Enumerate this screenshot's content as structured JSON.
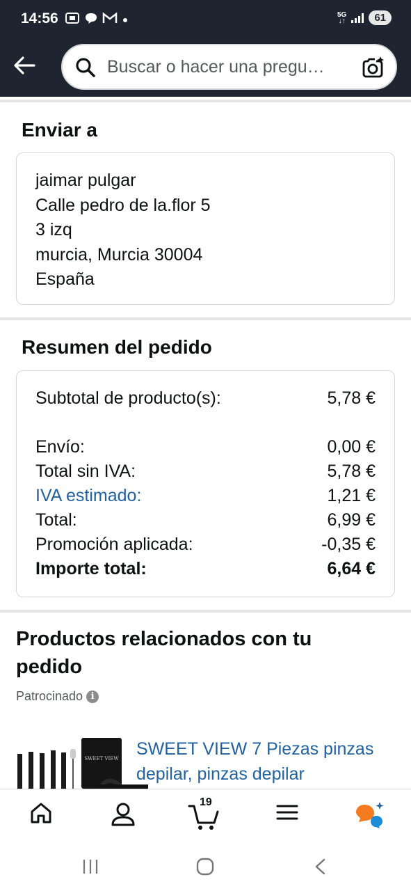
{
  "status_bar": {
    "time": "14:56",
    "network": "5G",
    "battery": "61"
  },
  "search": {
    "placeholder": "Buscar o hacer una pregu…"
  },
  "ship_to": {
    "title": "Enviar a",
    "address_lines": [
      "jaimar pulgar",
      "Calle pedro de la.flor 5",
      "3 izq",
      "murcia, Murcia 30004",
      "España"
    ]
  },
  "order_summary": {
    "title": "Resumen del pedido",
    "rows": [
      {
        "label": "Subtotal de producto(s):",
        "value": "5,78 €"
      },
      {
        "label": "Envío:",
        "value": "0,00 €"
      },
      {
        "label": "Total sin IVA:",
        "value": "5,78 €"
      },
      {
        "label": "IVA estimado:",
        "value": "1,21 €"
      },
      {
        "label": "Total:",
        "value": "6,99 €"
      },
      {
        "label": "Promoción aplicada:",
        "value": "-0,35 €"
      },
      {
        "label": "Importe total:",
        "value": "6,64 €"
      }
    ]
  },
  "related": {
    "title": "Productos relacionados con tu pedido",
    "sponsored": "Patrocinado",
    "product_title": "SWEET VIEW 7 Piezas pinzas depilar, pinzas depilar",
    "product_image_text": "SWEET VIEW"
  },
  "bottom_nav": {
    "cart_count": "19"
  },
  "colors": {
    "header_bg": "#1e2531",
    "link": "#2162a1",
    "divider": "#e3e6e6",
    "border": "#d5d9d9"
  }
}
